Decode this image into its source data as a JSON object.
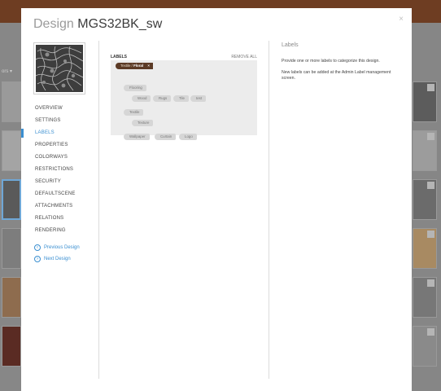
{
  "modal": {
    "title_label": "Design",
    "title_name": "MGS32BK_sw",
    "close_symbol": "×"
  },
  "nav": {
    "items": [
      {
        "label": "OVERVIEW"
      },
      {
        "label": "SETTINGS"
      },
      {
        "label": "LABELS"
      },
      {
        "label": "PROPERTIES"
      },
      {
        "label": "COLORWAYS"
      },
      {
        "label": "RESTRICTIONS"
      },
      {
        "label": "SECURITY"
      },
      {
        "label": "DEFAULTSCENE"
      },
      {
        "label": "ATTACHMENTS"
      },
      {
        "label": "RELATIONS"
      },
      {
        "label": "RENDERING"
      }
    ],
    "active_index": 2,
    "previous": "Previous Design",
    "next": "Next Design"
  },
  "labels": {
    "header": "LABELS",
    "remove_all": "REMOVE ALL",
    "selected": {
      "parent": "Textile /",
      "name": "Floral",
      "remove": "×"
    },
    "tags": [
      {
        "text": "Flooring"
      },
      {
        "text": "Wood"
      },
      {
        "text": "Rugs"
      },
      {
        "text": "Tile"
      },
      {
        "text": "test"
      },
      {
        "text": "Textile"
      },
      {
        "text": "Texture"
      },
      {
        "text": "Wallpaper"
      },
      {
        "text": "Curtain"
      },
      {
        "text": "Logo"
      }
    ]
  },
  "info": {
    "title": "Labels",
    "line1": "Provide one or more labels to categorize this design.",
    "line2": "New labels can be added at the Admin Label management screen."
  },
  "background": {
    "sidebar_text": "ors ▾"
  },
  "colors": {
    "accent": "#3a8fd1",
    "selected_tag": "#5b3a25",
    "topbar": "#6e3d22"
  }
}
